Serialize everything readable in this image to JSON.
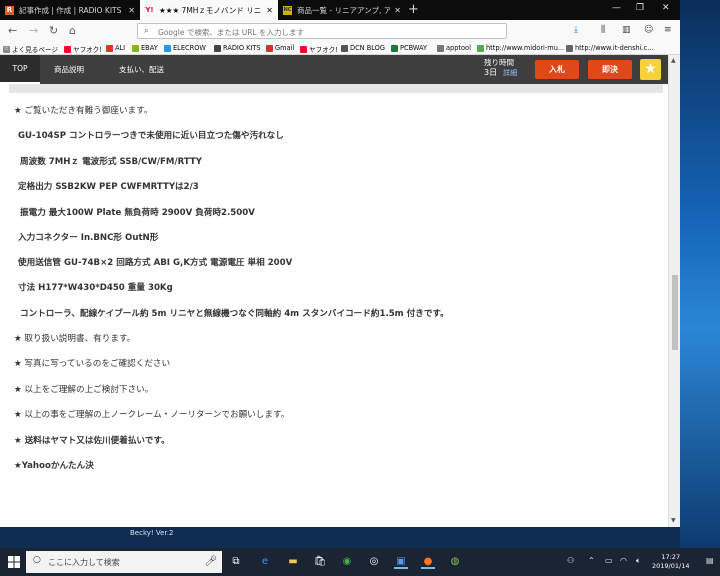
{
  "tabs": [
    {
      "label": "記事作成 | 作成 | RADIO KITS",
      "favicon": "R"
    },
    {
      "label": "★★★  7MHｚモノバンド リニ",
      "favicon": "Y!"
    },
    {
      "label": "商品一覧 - リニアアンプ, アマチュ",
      "favicon": "NC"
    }
  ],
  "urlbar": {
    "placeholder": "Google で検索、または URL を入力します"
  },
  "bookmarks": [
    {
      "label": "よく見るページ",
      "color": "#8a8a8a"
    },
    {
      "label": "ヤフオク!",
      "color": "#ff0033"
    },
    {
      "label": "ALI",
      "color": "#e43225"
    },
    {
      "label": "EBAY",
      "color": "#86b817"
    },
    {
      "label": "ELECROW",
      "color": "#2196f3"
    },
    {
      "label": "RADIO KITS",
      "color": "#444"
    },
    {
      "label": "Gmail",
      "color": "#d93025"
    },
    {
      "label": "ヤフオク!",
      "color": "#ff0033"
    },
    {
      "label": "DCN BLOG",
      "color": "#555"
    },
    {
      "label": "PCBWAY",
      "color": "#1a7a3a"
    },
    {
      "label": "apptool",
      "color": "#777"
    },
    {
      "label": "http://www.midori-mu...",
      "color": "#4caf50"
    },
    {
      "label": "http://www.it-denshi.c...",
      "color": "#666"
    }
  ],
  "site_nav": {
    "top": "TOP",
    "items": [
      "商品説明",
      "支払い、配送"
    ],
    "remaining_label": "残り時間",
    "remaining_value": "3日",
    "detail_link": "詳細",
    "bid_label": "入札",
    "buyout_label": "即決"
  },
  "description": [
    "★ ご覧いただき有難う御座います。",
    "GU-104SP コントロラーつきで未使用に近い目立つた傷や汚れなし",
    "周波数 7MHｚ 電波形式 SSB/CW/FM/RTTY",
    "定格出力 SSB2KW PEP CWFMRTTYは2/3",
    "振電力  最大100W Plate 無負荷時 2900V 負荷時2.500V",
    "入力コネクター In.BNC形 OutN形",
    "使用送信管 GU-74B×2 回路方式 ABI G,K方式 電源電圧 単相 200V",
    "寸法 H177*W430*D450   重量 30Kg",
    "コントローラ、配線ケイブール約 5m リニヤと無線機つなぐ同軸約 4m スタンバイコード約1.5m 付きです。",
    "★ 取り扱い説明書、有ります。",
    "★ 写真に写っているのをご確認ください",
    "★ 以上をご理解の上ご検討下さい。",
    "★ 以上の事をご理解の上ノークレーム・ノーリターンでお願いします。",
    "★  送料はヤマト又は佐川便着払いです。",
    "★Yahooかんたん決"
  ],
  "desktop": {
    "becky_label": "Becky! Ver.2"
  },
  "taskbar": {
    "search_placeholder": "ここに入力して検索",
    "time": "17:27",
    "date": "2019/01/14"
  }
}
